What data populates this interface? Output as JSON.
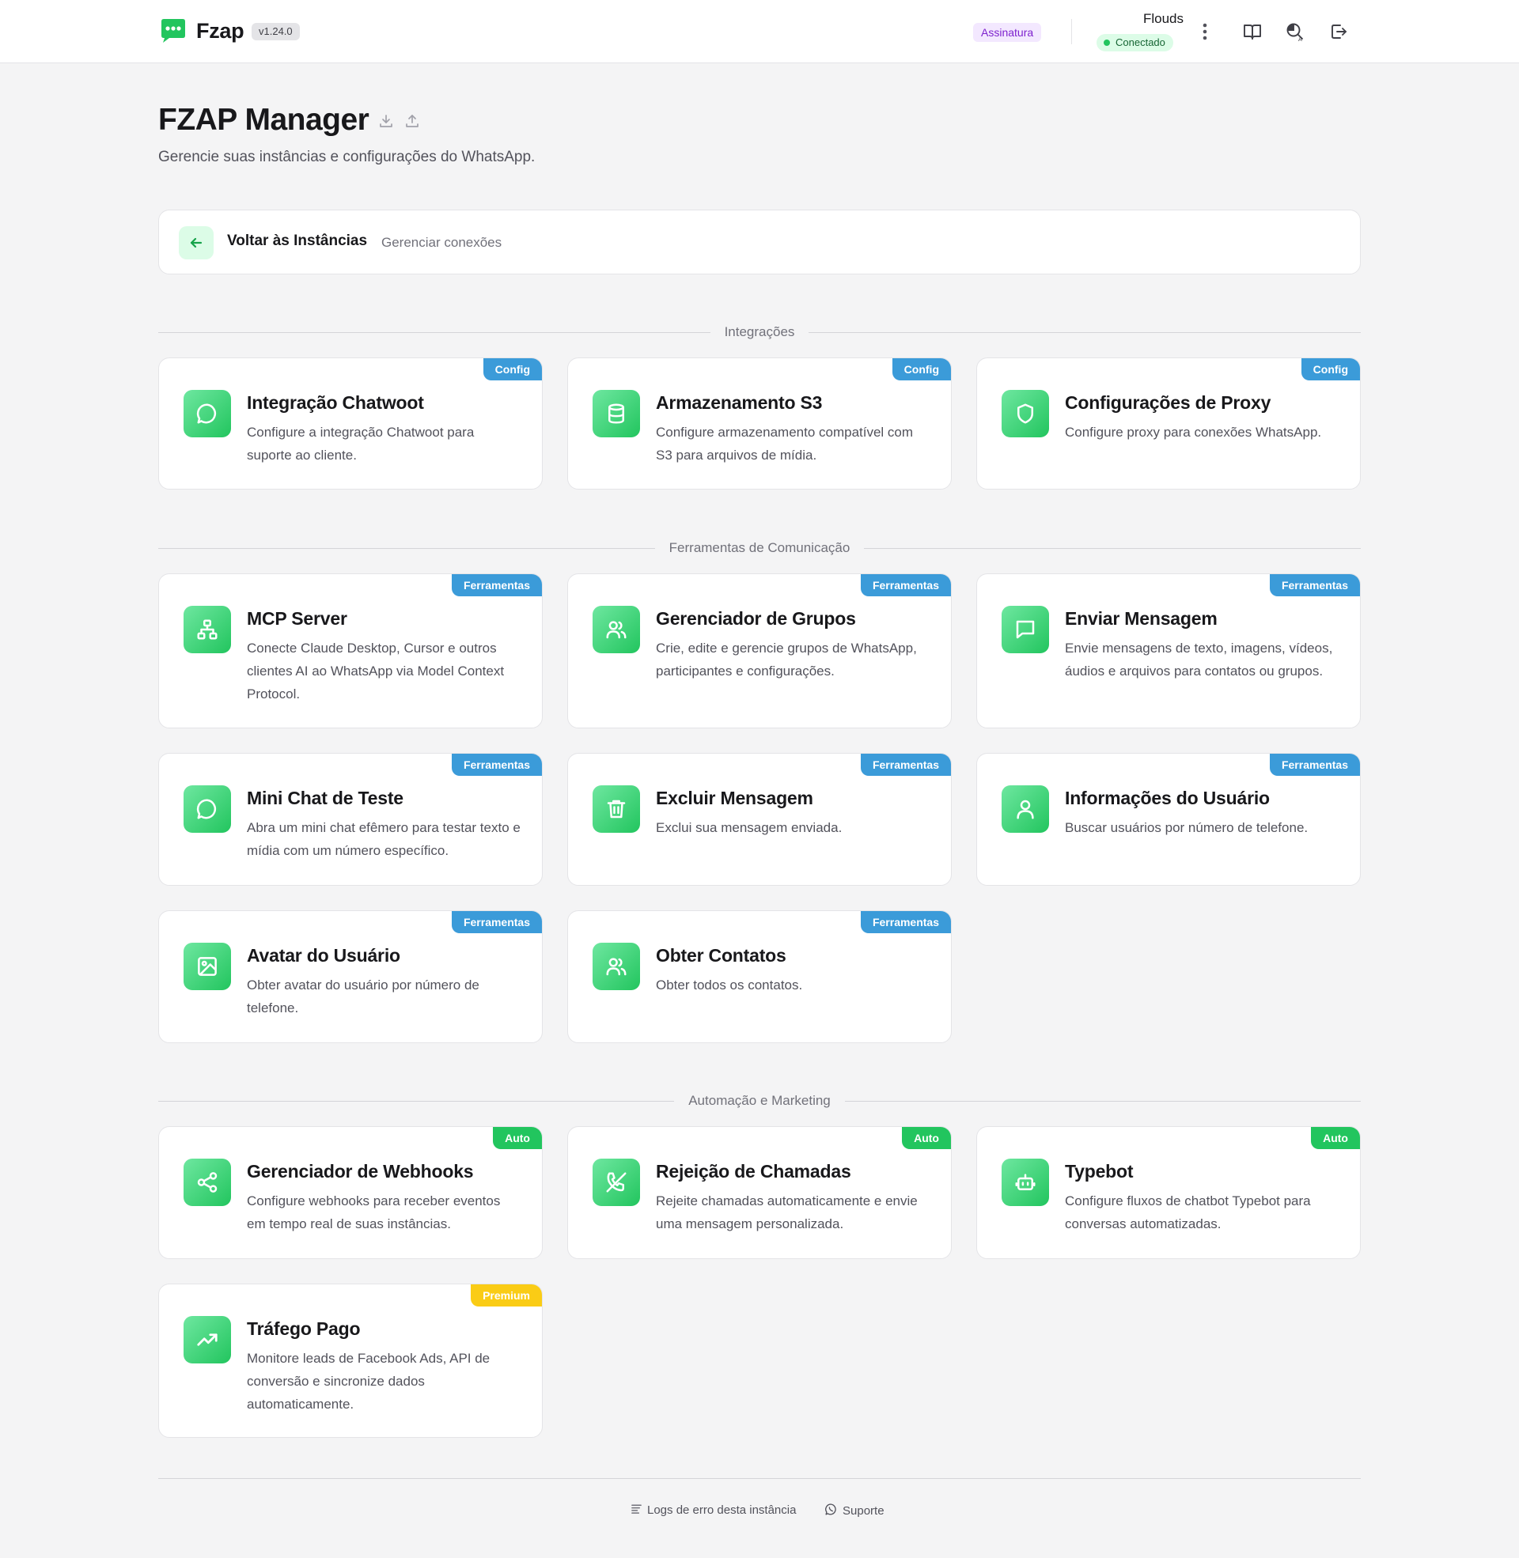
{
  "header": {
    "app_name": "Fzap",
    "version": "v1.24.0",
    "subscription_label": "Assinatura",
    "user_name": "Flouds",
    "status": "Conectado",
    "brand_color": "#22c55e",
    "icons": [
      "more-vertical-icon",
      "book-icon",
      "theme-search-icon",
      "logout-icon"
    ]
  },
  "page": {
    "title": "FZAP Manager",
    "subtitle": "Gerencie suas instâncias e configurações do WhatsApp.",
    "title_icons": [
      "download-icon",
      "upload-icon"
    ]
  },
  "back": {
    "title": "Voltar às Instâncias",
    "subtitle": "Gerenciar conexões"
  },
  "sections": [
    {
      "label": "Integrações",
      "cards": [
        {
          "tag": "Config",
          "icon": "message-circle-icon",
          "title": "Integração Chatwoot",
          "desc": "Configure a integração Chatwoot para suporte ao cliente."
        },
        {
          "tag": "Config",
          "icon": "database-icon",
          "title": "Armazenamento S3",
          "desc": "Configure armazenamento compatível com S3 para arquivos de mídia."
        },
        {
          "tag": "Config",
          "icon": "shield-icon",
          "title": "Configurações de Proxy",
          "desc": "Configure proxy para conexões WhatsApp."
        }
      ]
    },
    {
      "label": "Ferramentas de Comunicação",
      "cards": [
        {
          "tag": "Ferramentas",
          "icon": "network-icon",
          "title": "MCP Server",
          "desc": "Conecte Claude Desktop, Cursor e outros clientes AI ao WhatsApp via Model Context Protocol."
        },
        {
          "tag": "Ferramentas",
          "icon": "users-icon",
          "title": "Gerenciador de Grupos",
          "desc": "Crie, edite e gerencie grupos de WhatsApp, participantes e configurações."
        },
        {
          "tag": "Ferramentas",
          "icon": "message-square-icon",
          "title": "Enviar Mensagem",
          "desc": "Envie mensagens de texto, imagens, vídeos, áudios e arquivos para contatos ou grupos."
        },
        {
          "tag": "Ferramentas",
          "icon": "message-circle-icon",
          "title": "Mini Chat de Teste",
          "desc": "Abra um mini chat efêmero para testar texto e mídia com um número específico."
        },
        {
          "tag": "Ferramentas",
          "icon": "trash-icon",
          "title": "Excluir Mensagem",
          "desc": "Exclui sua mensagem enviada."
        },
        {
          "tag": "Ferramentas",
          "icon": "user-icon",
          "title": "Informações do Usuário",
          "desc": "Buscar usuários por número de telefone."
        },
        {
          "tag": "Ferramentas",
          "icon": "image-icon",
          "title": "Avatar do Usuário",
          "desc": "Obter avatar do usuário por número de telefone."
        },
        {
          "tag": "Ferramentas",
          "icon": "users-icon",
          "title": "Obter Contatos",
          "desc": "Obter todos os contatos."
        }
      ]
    },
    {
      "label": "Automação e Marketing",
      "cards": [
        {
          "tag": "Auto",
          "icon": "share-icon",
          "title": "Gerenciador de Webhooks",
          "desc": "Configure webhooks para receber eventos em tempo real de suas instâncias."
        },
        {
          "tag": "Auto",
          "icon": "phone-off-icon",
          "title": "Rejeição de Chamadas",
          "desc": "Rejeite chamadas automaticamente e envie uma mensagem personalizada."
        },
        {
          "tag": "Auto",
          "icon": "bot-icon",
          "title": "Typebot",
          "desc": "Configure fluxos de chatbot Typebot para conversas automatizadas."
        },
        {
          "tag": "Premium",
          "icon": "trending-up-icon",
          "title": "Tráfego Pago",
          "desc": "Monitore leads de Facebook Ads, API de conversão e sincronize dados automaticamente."
        }
      ]
    }
  ],
  "footer": {
    "logs_label": "Logs de erro desta instância",
    "support_label": "Suporte"
  }
}
